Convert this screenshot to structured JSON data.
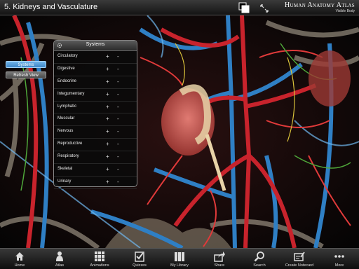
{
  "header": {
    "title": "5. Kidneys and Vasculature",
    "brand_main": "Human Anatomy Atlas",
    "brand_sub": "Visible Body"
  },
  "side_buttons": {
    "systems": "Systems",
    "refresh": "Refresh View"
  },
  "systems_panel": {
    "title": "Systems",
    "items": [
      {
        "label": "Circulatory",
        "add": "+",
        "remove": "-"
      },
      {
        "label": "Digestive",
        "add": "+",
        "remove": "-"
      },
      {
        "label": "Endocrine",
        "add": "+",
        "remove": "-"
      },
      {
        "label": "Integumentary",
        "add": "+",
        "remove": "-"
      },
      {
        "label": "Lymphatic",
        "add": "+",
        "remove": "-"
      },
      {
        "label": "Muscular",
        "add": "+",
        "remove": "-"
      },
      {
        "label": "Nervous",
        "add": "+",
        "remove": "-"
      },
      {
        "label": "Reproductive",
        "add": "+",
        "remove": "-"
      },
      {
        "label": "Respiratory",
        "add": "+",
        "remove": "-"
      },
      {
        "label": "Skeletal",
        "add": "+",
        "remove": "-"
      },
      {
        "label": "Urinary",
        "add": "+",
        "remove": "-"
      }
    ]
  },
  "toolbar": {
    "tabs": [
      {
        "label": "Home",
        "icon": "home-icon"
      },
      {
        "label": "Atlas",
        "icon": "person-icon"
      },
      {
        "label": "Animations",
        "icon": "grid-icon"
      },
      {
        "label": "Quizzes",
        "icon": "checklist-icon"
      },
      {
        "label": "My Library",
        "icon": "library-icon"
      },
      {
        "label": "Share",
        "icon": "share-icon"
      },
      {
        "label": "Search",
        "icon": "search-icon"
      },
      {
        "label": "Create Notecard",
        "icon": "notecard-icon"
      },
      {
        "label": "More",
        "icon": "more-icon"
      }
    ]
  },
  "colors": {
    "artery": "#c8232c",
    "vein": "#2f7fc4",
    "nerve": "#d9c23a",
    "lymph": "#4fa83a",
    "kidney": "#c95a55",
    "accent": "#4a9de0"
  }
}
